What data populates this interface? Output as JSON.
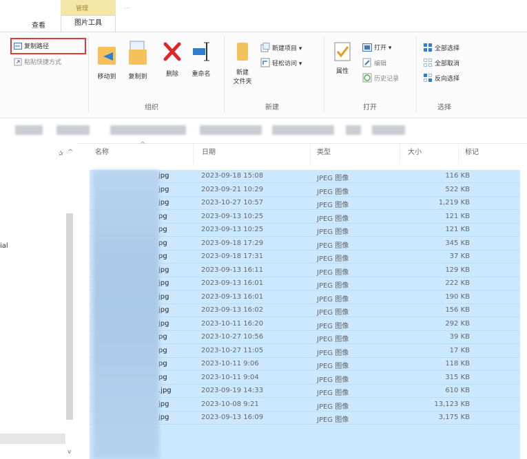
{
  "tabs": {
    "view": "查看",
    "picture_tools": "图片工具",
    "context_group": "管理",
    "dim": "..."
  },
  "ribbon": {
    "clipboard": {
      "copy_path": "复制路径",
      "paste_shortcut": "粘贴快捷方式"
    },
    "organize": {
      "label": "组织",
      "move_to": "移动到",
      "copy_to": "复制到",
      "delete": "删除",
      "rename": "重命名"
    },
    "new": {
      "label": "新建",
      "new_folder_line1": "新建",
      "new_folder_line2": "文件夹",
      "new_item": "新建项目 ▾",
      "easy_access": "轻松访问 ▾"
    },
    "open": {
      "label": "打开",
      "properties": "属性",
      "open": "打开 ▾",
      "edit": "编辑",
      "history": "历史记录"
    },
    "select": {
      "label": "选择",
      "select_all": "全部选择",
      "select_none": "全部取消",
      "invert": "反向选择"
    }
  },
  "nav": {
    "partial_label": "ial"
  },
  "columns": {
    "name": "名称",
    "date": "日期",
    "type": "类型",
    "size": "大小",
    "tags": "标记"
  },
  "files": [
    {
      "ext": "jpg",
      "date": "2023-09-18 15:08",
      "type": "JPEG 图像",
      "size": "116 KB"
    },
    {
      "ext": "jpg",
      "date": "2023-09-21 10:29",
      "type": "JPEG 图像",
      "size": "522 KB"
    },
    {
      "ext": "jpg",
      "date": "2023-10-27 10:57",
      "type": "JPEG 图像",
      "size": "1,219 KB"
    },
    {
      "ext": "pg",
      "date": "2023-09-13 10:25",
      "type": "JPEG 图像",
      "size": "121 KB"
    },
    {
      "ext": "pg",
      "date": "2023-09-13 10:25",
      "type": "JPEG 图像",
      "size": "121 KB"
    },
    {
      "ext": "pg",
      "date": "2023-09-18 17:29",
      "type": "JPEG 图像",
      "size": "345 KB"
    },
    {
      "ext": "pg",
      "date": "2023-09-18 17:31",
      "type": "JPEG 图像",
      "size": "37 KB"
    },
    {
      "ext": "jpg",
      "date": "2023-09-13 16:11",
      "type": "JPEG 图像",
      "size": "129 KB"
    },
    {
      "ext": "jpg",
      "date": "2023-09-13 16:01",
      "type": "JPEG 图像",
      "size": "222 KB"
    },
    {
      "ext": "jpg",
      "date": "2023-09-13 16:01",
      "type": "JPEG 图像",
      "size": "190 KB"
    },
    {
      "ext": "jpg",
      "date": "2023-09-13 16:02",
      "type": "JPEG 图像",
      "size": "156 KB"
    },
    {
      "ext": "jpg",
      "date": "2023-10-11 16:20",
      "type": "JPEG 图像",
      "size": "292 KB"
    },
    {
      "ext": "pg",
      "date": "2023-10-27 10:56",
      "type": "JPEG 图像",
      "size": "39 KB"
    },
    {
      "ext": "pg",
      "date": "2023-10-27 11:05",
      "type": "JPEG 图像",
      "size": "17 KB"
    },
    {
      "ext": "pg",
      "date": "2023-10-11 9:06",
      "type": "JPEG 图像",
      "size": "118 KB"
    },
    {
      "ext": "pg",
      "date": "2023-10-11 9:04",
      "type": "JPEG 图像",
      "size": "315 KB"
    },
    {
      "ext": ".jpg",
      "date": "2023-09-19 14:33",
      "type": "JPEG 图像",
      "size": "610 KB"
    },
    {
      "ext": "jpg",
      "date": "2023-10-08 9:21",
      "type": "JPEG 图像",
      "size": "13,123 KB"
    },
    {
      "ext": "jpg",
      "date": "2023-09-13 16:09",
      "type": "JPEG 图像",
      "size": "3,175 KB"
    }
  ]
}
